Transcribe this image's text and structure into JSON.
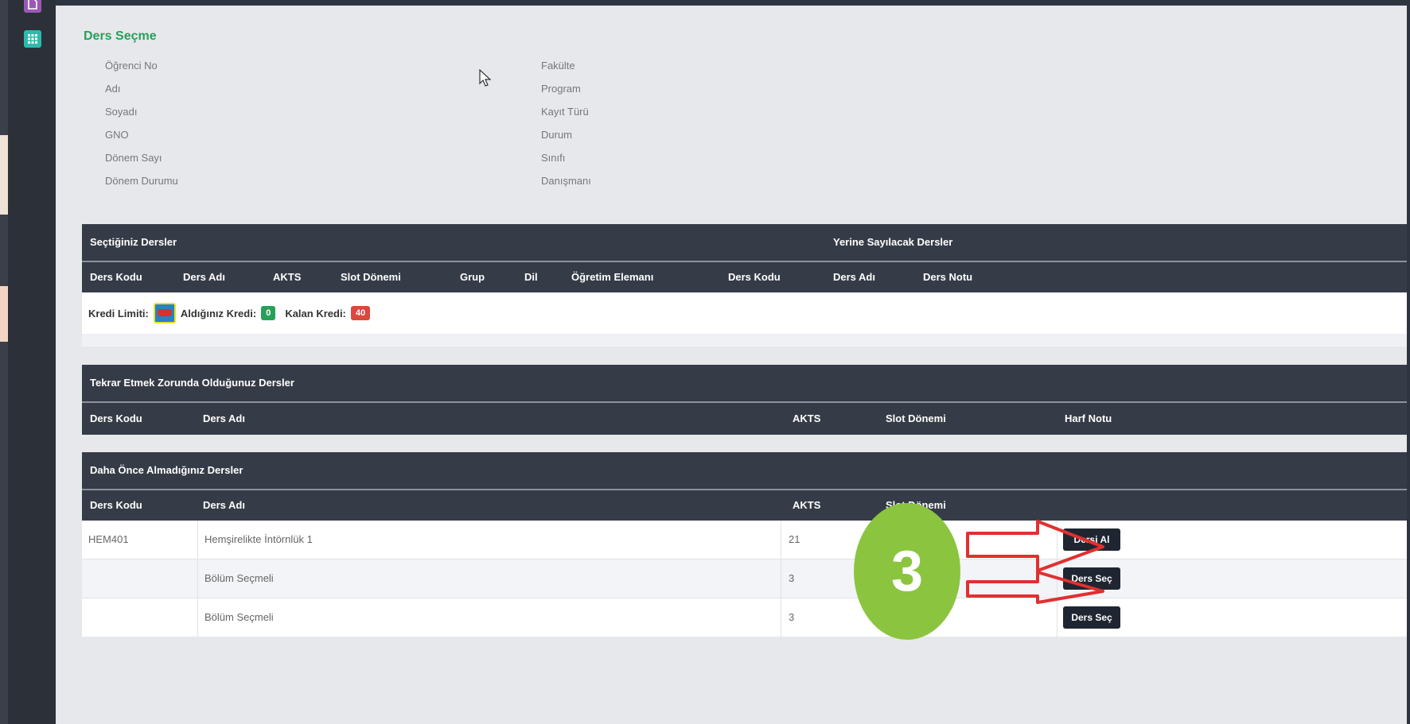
{
  "page_title": "Ders Seçme",
  "student_info_left": [
    "Öğrenci No",
    "Adı",
    "Soyadı",
    "GNO",
    "Dönem Sayı",
    "Dönem Durumu"
  ],
  "student_info_right": [
    "Fakülte",
    "Program",
    "Kayıt Türü",
    "Durum",
    "Sınıfı",
    "Danışmanı"
  ],
  "selected": {
    "header_left": "Seçtiğiniz Dersler",
    "header_right": "Yerine Sayılacak Dersler",
    "columns": [
      "Ders Kodu",
      "Ders Adı",
      "AKTS",
      "Slot Dönemi",
      "Grup",
      "Dil",
      "Öğretim Elemanı",
      "Ders Kodu",
      "Ders Adı",
      "Ders Notu"
    ],
    "kredi_limit_label": "Kredi Limiti:",
    "aldiginiz_label": "Aldığınız Kredi:",
    "aldiginiz_value": "0",
    "kalan_label": "Kalan Kredi:",
    "kalan_value": "40"
  },
  "repeat": {
    "header": "Tekrar Etmek Zorunda Olduğunuz Dersler",
    "columns": [
      "Ders Kodu",
      "Ders Adı",
      "AKTS",
      "Slot Dönemi",
      "Harf Notu"
    ]
  },
  "notTaken": {
    "header": "Daha Önce Almadığınız Dersler",
    "columns": [
      "Ders Kodu",
      "Ders Adı",
      "AKTS",
      "Slot Dönemi"
    ],
    "rows": [
      {
        "code": "HEM401",
        "name": "Hemşirelikte İntörnlük 1",
        "akts": "21",
        "button": "Dersi Al"
      },
      {
        "code": "",
        "name": "Bölüm Seçmeli",
        "akts": "3",
        "button": "Ders Seç"
      },
      {
        "code": "",
        "name": "Bölüm Seçmeli",
        "akts": "3",
        "button": "Ders Seç"
      }
    ]
  },
  "annotation": {
    "step_number": "3",
    "circle_color": "#8bc53f",
    "arrow_color": "#e03030"
  },
  "colors": {
    "title_green": "#27a05a",
    "badge_green": "#27a05a",
    "badge_red": "#d9493c",
    "dark_header": "#363c47"
  }
}
